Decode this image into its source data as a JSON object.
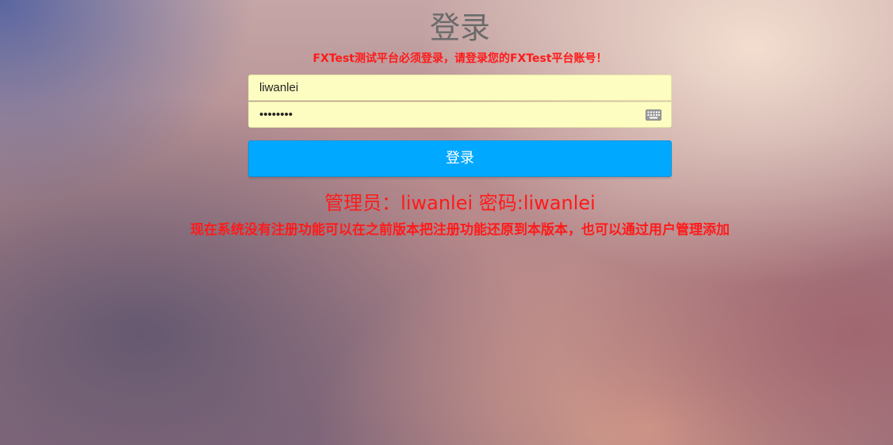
{
  "page": {
    "title": "登录",
    "notice": "FXTest测试平台必须登录，请登录您的FXTest平台账号！"
  },
  "form": {
    "username_value": "liwanlei",
    "password_value": "liwanlei",
    "submit_label": "登录"
  },
  "info": {
    "admin_line": "管理员：liwanlei 密码:liwanlei",
    "register_note": "现在系统没有注册功能可以在之前版本把注册功能还原到本版本，也可以通过用户管理添加"
  },
  "colors": {
    "accent": "#00a8ff",
    "warning": "#ff1a1a",
    "input_bg": "#fdfdc1"
  },
  "icons": {
    "password_field": "keyboard-icon"
  }
}
